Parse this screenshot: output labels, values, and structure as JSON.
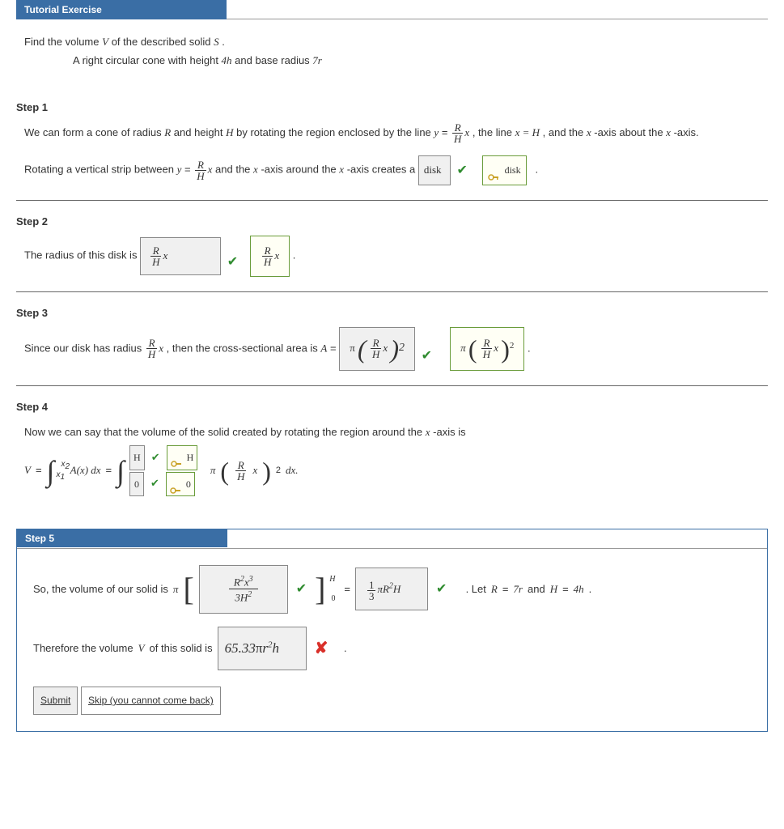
{
  "header": {
    "title": "Tutorial Exercise"
  },
  "intro": {
    "line1_a": "Find the volume ",
    "line1_v": "V",
    "line1_b": " of the described solid ",
    "line1_s": "S",
    "line1_c": ".",
    "line2_a": "A right circular cone with height ",
    "line2_h": "4h",
    "line2_b": " and base radius ",
    "line2_r": "7r"
  },
  "step1": {
    "title": "Step 1",
    "p1_a": "We can form a cone of radius ",
    "p1_r": "R",
    "p1_b": " and height ",
    "p1_h": "H",
    "p1_c": " by rotating the region enclosed by the line  ",
    "p1_y": "y",
    "p1_eq": " = ",
    "frac_num": "R",
    "frac_den": "H",
    "p1_x": "x",
    "p1_d": ",  the line ",
    "p1_e": "x = H",
    "p1_f": ", and the ",
    "p1_g": "x",
    "p1_h2": "-axis about the ",
    "p1_i": "x",
    "p1_j": "-axis.",
    "p2_a": "Rotating a vertical strip between  ",
    "p2_y": "y",
    "p2_eq": " = ",
    "p2_b": " and the ",
    "p2_x2": "x",
    "p2_c": "-axis around the ",
    "p2_x3": "x",
    "p2_d": "-axis creates a ",
    "input1": "disk",
    "answer1": "disk",
    "period": "."
  },
  "step2": {
    "title": "Step 2",
    "text": "The radius of this disk is ",
    "input_num": "R",
    "input_den": "H",
    "input_x": "x",
    "ans_num": "R",
    "ans_den": "H",
    "ans_x": "x",
    "period": "."
  },
  "step3": {
    "title": "Step 3",
    "a": "Since our disk has radius ",
    "frac_num": "R",
    "frac_den": "H",
    "x": "x",
    "b": ", then the cross-sectional area is ",
    "A": "A",
    "eq": " = ",
    "pi": "π",
    "exp": "2",
    "ans_pi": "π",
    "period": "."
  },
  "step4": {
    "title": "Step 4",
    "line1": "Now we can say that the volume of the solid created by rotating the region around the ",
    "x": "x",
    "line1b": "-axis is",
    "V": "V",
    "eq": " = ",
    "int_upper": "x₂",
    "int_lower": "x₁",
    "Ax": "A(x) dx",
    "eq2": " = ",
    "upper_in": "H",
    "lower_in": "0",
    "upper_ans": "H",
    "lower_ans": "0",
    "pi": "π",
    "frac_num": "R",
    "frac_den": "H",
    "xvar": "x",
    "exp": "2",
    "dx": " dx."
  },
  "step5": {
    "title": "Step 5",
    "a": "So, the volume of our solid is  ",
    "pi": "π",
    "in_num": "R²x³",
    "in_den": "3H²",
    "brk_upper": "H",
    "brk_lower": "0",
    "eq": " = ",
    "ans_frac_num": "1",
    "ans_frac_den": "3",
    "ans_rest": "πR²H",
    "b": ". Let ",
    "R": "R",
    "eq2": " = ",
    "rv": "7r",
    "and": " and ",
    "H": "H",
    "hv": "4h",
    "c": ".",
    "line2a": "Therefore the volume ",
    "V": "V",
    "line2b": " of this solid is ",
    "final_input": "65.33πr²h",
    "period": ".",
    "submit": "Submit",
    "skip": "Skip (you cannot come back)"
  }
}
